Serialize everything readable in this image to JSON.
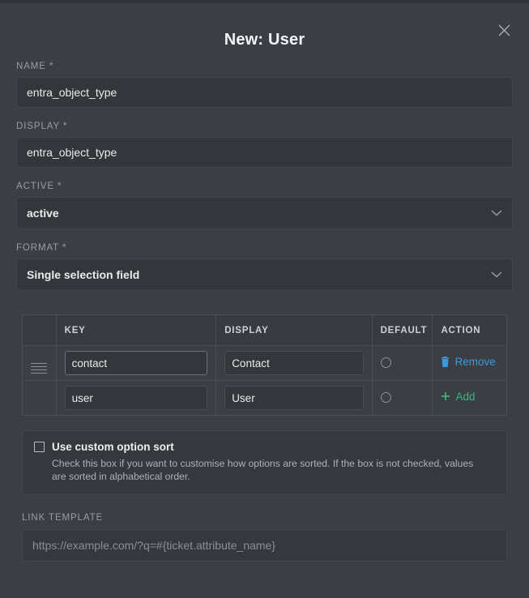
{
  "modal": {
    "title": "New: User",
    "close_icon": "close-icon"
  },
  "fields": {
    "name": {
      "label": "NAME *",
      "value": "entra_object_type"
    },
    "display": {
      "label": "DISPLAY *",
      "value": "entra_object_type"
    },
    "active": {
      "label": "ACTIVE *",
      "value": "active",
      "chevron_icon": "chevron-down-icon"
    },
    "format": {
      "label": "FORMAT *",
      "value": "Single selection field",
      "chevron_icon": "chevron-down-icon"
    }
  },
  "options_table": {
    "headers": {
      "handle": "",
      "key": "KEY",
      "display": "DISPLAY",
      "default": "DEFAULT",
      "action": "ACTION"
    },
    "rows": [
      {
        "handle_icon": "drag-handle-icon",
        "key": "contact",
        "display": "Contact",
        "default_selected": false,
        "action_label": "Remove",
        "action_icon": "trash-icon",
        "action_type": "remove"
      },
      {
        "handle_icon": "",
        "key": "user",
        "display": "User",
        "default_selected": false,
        "action_label": "Add",
        "action_icon": "plus-icon",
        "action_type": "add"
      }
    ]
  },
  "custom_sort": {
    "checked": false,
    "label": "Use custom option sort",
    "description": "Check this box if you want to customise how options are sorted. If the box is not checked, values are sorted in alphabetical order."
  },
  "link_template": {
    "label": "LINK TEMPLATE",
    "value": "",
    "placeholder": "https://example.com/?q=#{ticket.attribute_name}"
  },
  "colors": {
    "background": "#3b3e44",
    "input_background": "#33363b",
    "remove_accent": "#389bdd",
    "add_accent": "#38b87c",
    "label_text": "#9a9ea3"
  }
}
